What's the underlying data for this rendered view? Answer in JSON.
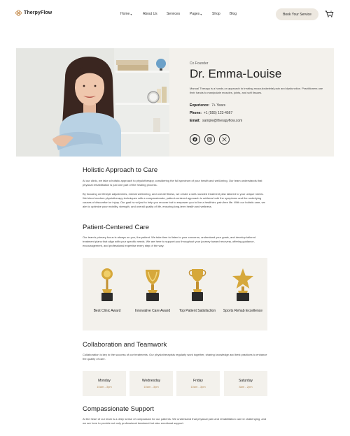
{
  "header": {
    "brand": "TherpyFlow",
    "nav": [
      {
        "label": "Home",
        "caret": true
      },
      {
        "label": "About Us",
        "caret": false
      },
      {
        "label": "Services",
        "caret": false
      },
      {
        "label": "Pages",
        "caret": true
      },
      {
        "label": "Shop",
        "caret": false
      },
      {
        "label": "Blog",
        "caret": false
      }
    ],
    "cta_label": "Book Your Service",
    "cart_count": "0"
  },
  "profile": {
    "role": "Co Founder",
    "name": "Dr. Emma-Louise",
    "bio": "Manual Therapy is a hands-on approach to treating musculoskeletal pain and dysfunction. Practitioners use their hands to manipulate muscles, joints, and soft tissues.",
    "experience_label": "Experience:",
    "experience_value": "7+ Years",
    "phone_label": "Phone:",
    "phone_value": "+1 (555) 123-4567",
    "email_label": "Email:",
    "email_value": "sample@therapyflow.com",
    "socials": [
      "facebook-icon",
      "instagram-icon",
      "x-icon"
    ]
  },
  "sections": {
    "holistic": {
      "title": "Holistic Approach to Care",
      "p1": "At our clinic, we take a holistic approach to physiotherapy, considering the full spectrum of your health and well-being. Our team understands that physical rehabilitation is just one part of the healing process.",
      "p2": "By focusing on lifestyle adjustments, mental well-being, and overall fitness, we create a well-rounded treatment plan tailored to your unique needs. We blend modern physiotherapy techniques with a compassionate, patient-centered approach to address both the symptoms and the underlying causes of discomfort or injury. Our goal is not just to help you recover but to empower you to live a healthier, pain-free life. With our holistic care, we aim to optimize your mobility, strength, and overall quality of life, ensuring long-term health and wellness."
    },
    "patient": {
      "title": "Patient-Centered Care",
      "p1": "Our team's primary focus is always on you, the patient. We take time to listen to your concerns, understand your goals, and develop tailored treatment plans that align with your specific needs. We are here to support you throughout your journey toward recovery, offering guidance, encouragement, and professional expertise every step of the way."
    },
    "awards": [
      {
        "label": "Best Clinic Award",
        "icon": "trophy-round-icon"
      },
      {
        "label": "Innovative Care Award",
        "icon": "trophy-laurel-icon"
      },
      {
        "label": "Top Patient Satisfaction",
        "icon": "trophy-cup-icon"
      },
      {
        "label": "Sports Rehab Excellence",
        "icon": "trophy-star-icon"
      }
    ],
    "collab": {
      "title": "Collaboration and Teamwork",
      "p1": "Collaboration is key to the success of our treatments. Our physiotherapists regularly work together, sharing knowledge and best practices to enhance the quality of care."
    },
    "schedule": [
      {
        "day": "Monday",
        "time": "10am - 3pm"
      },
      {
        "day": "Wednesday",
        "time": "10am - 3pm"
      },
      {
        "day": "Friday",
        "time": "10am - 3pm"
      },
      {
        "day": "Saturday",
        "time": "8am - 2pm"
      }
    ],
    "compassion": {
      "title": "Compassionate Support",
      "p1": "At the heart of our team is a deep sense of compassion for our patients. We understand that physical pain and rehabilitation can be challenging, and we are here to provide not only professional treatment but also emotional support."
    }
  },
  "colors": {
    "accent_bg": "#f3f1ec",
    "cta_bg": "#ede8e0",
    "gold": "#c99a2e",
    "time_text": "#b58a57"
  }
}
